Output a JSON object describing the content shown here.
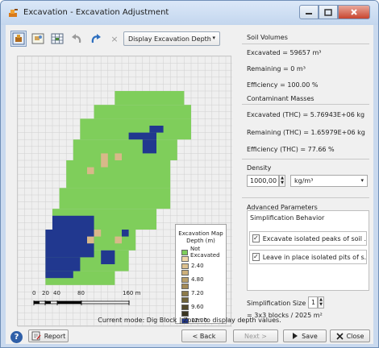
{
  "window": {
    "title": "Excavation - Excavation Adjustment"
  },
  "toolbar": {
    "close_x": "×",
    "combo_value": "Display Excavation Depth",
    "combo_arrow": "▾"
  },
  "map": {
    "legend": {
      "title_line1": "Excavation Map",
      "title_line2": "Depth (m)",
      "items": [
        {
          "label": "Not Excavated",
          "color": "#7fce5b"
        },
        {
          "label": "",
          "color": "#f1d7a8"
        },
        {
          "label": "2.40",
          "color": "#dcc08f"
        },
        {
          "label": "",
          "color": "#cdb07b"
        },
        {
          "label": "4.80",
          "color": "#b89e69"
        },
        {
          "label": "",
          "color": "#a48a56"
        },
        {
          "label": "7.20",
          "color": "#8c7a4a"
        },
        {
          "label": "",
          "color": "#6f6338"
        },
        {
          "label": "9.60",
          "color": "#52492a"
        },
        {
          "label": "",
          "color": "#3a3520"
        },
        {
          "label": "12.00",
          "color": "#21388f"
        }
      ]
    },
    "scale_labels": [
      "0",
      "20",
      "40",
      "80",
      "160 m"
    ],
    "colors": {
      "green": "#7fce5b",
      "navy": "#21388f",
      "tan": "#d8b889",
      "grid_empty": "#efefef",
      "grid_line": "#cfcfcf"
    }
  },
  "volumes": {
    "title": "Soil Volumes",
    "excavated": "Excavated  = 59657 m³",
    "remaining": "Remaining  = 0 m³",
    "efficiency": "Efficiency  = 100.00 %"
  },
  "masses": {
    "title": "Contaminant Masses",
    "excavated": "Excavated (THC) = 5.76943E+06 kg",
    "remaining": "Remaining (THC) = 1.65979E+06 kg",
    "efficiency": "Efficiency (THC) = 77.66 %"
  },
  "density": {
    "title": "Density",
    "value": "1000,00",
    "unit": "kg/m³",
    "arrow": "▾"
  },
  "advanced": {
    "title": "Advanced Parameters",
    "simplification_behavior": "Simplification Behavior",
    "checks": [
      {
        "label": "Excavate isolated peaks of soil ...",
        "checked": "✓"
      },
      {
        "label": "Leave in place isolated pits of s...",
        "checked": "✓"
      }
    ],
    "size_label": "Simplification Size",
    "size_value": "1",
    "blocks_text": "= 3x3 blocks / 2025 m²"
  },
  "status": {
    "text": "Current mode: Dig Block | Zoom to display depth values."
  },
  "buttons": {
    "help": "?",
    "report": "Report",
    "back": "< Back",
    "next": "Next >",
    "save": "Save",
    "close": "Close"
  }
}
